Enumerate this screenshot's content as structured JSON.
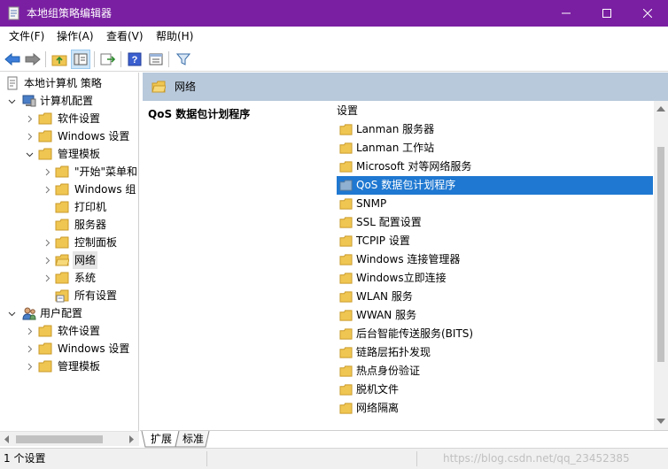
{
  "window": {
    "title": "本地组策略编辑器"
  },
  "menu": [
    {
      "label": "文件(F)"
    },
    {
      "label": "操作(A)"
    },
    {
      "label": "查看(V)"
    },
    {
      "label": "帮助(H)"
    }
  ],
  "tree": {
    "root": "本地计算机 策略",
    "computer_config": "计算机配置",
    "software_settings": "软件设置",
    "windows_settings": "Windows 设置",
    "admin_templates": "管理模板",
    "start_menu": "\"开始\"菜单和",
    "windows_components": "Windows 组",
    "printers": "打印机",
    "server": "服务器",
    "control_panel": "控制面板",
    "network": "网络",
    "system": "系统",
    "all_settings": "所有设置",
    "user_config": "用户配置",
    "user_software_settings": "软件设置",
    "user_windows_settings": "Windows 设置",
    "user_admin_templates": "管理模板"
  },
  "content": {
    "header": "网络",
    "selected_title": "QoS 数据包计划程序",
    "column_header": "设置",
    "items": [
      "Lanman 服务器",
      "Lanman 工作站",
      "Microsoft 对等网络服务",
      "QoS 数据包计划程序",
      "SNMP",
      "SSL 配置设置",
      "TCPIP 设置",
      "Windows 连接管理器",
      "Windows立即连接",
      "WLAN 服务",
      "WWAN 服务",
      "后台智能传送服务(BITS)",
      "链路层拓扑发现",
      "热点身份验证",
      "脱机文件",
      "网络隔离"
    ]
  },
  "tabs": {
    "extended": "扩展",
    "standard": "标准"
  },
  "status": {
    "text": "1 个设置",
    "watermark": "https://blog.csdn.net/qq_23452385"
  },
  "colors": {
    "titlebar": "#7a1fa2",
    "selection": "#1f78d1",
    "header": "#b8c9db",
    "folder": "#f0c652"
  }
}
